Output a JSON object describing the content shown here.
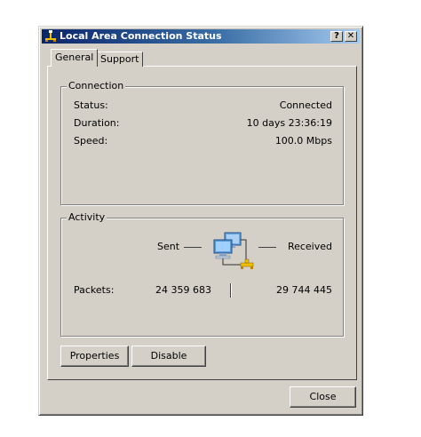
{
  "window": {
    "title": "Local Area Connection Status",
    "help_label": "?",
    "close_label": "✕",
    "titlebar_colors": [
      "#0a246a",
      "#a6caf0"
    ],
    "face_color": "#d4d0c8"
  },
  "tabs": [
    {
      "label": "General",
      "selected": true
    },
    {
      "label": "Support",
      "selected": false
    }
  ],
  "connection": {
    "legend": "Connection",
    "rows": [
      {
        "label": "Status:",
        "value": "Connected"
      },
      {
        "label": "Duration:",
        "value": "10 days 23:36:19"
      },
      {
        "label": "Speed:",
        "value": "100.0 Mbps"
      }
    ]
  },
  "activity": {
    "legend": "Activity",
    "sent_label": "Sent",
    "received_label": "Received",
    "packets_label": "Packets:",
    "packets_sent": "24 359 683",
    "packets_received": "29 744 445",
    "icon": "network-computers-icon"
  },
  "buttons": {
    "properties": "Properties",
    "disable": "Disable",
    "close": "Close"
  }
}
